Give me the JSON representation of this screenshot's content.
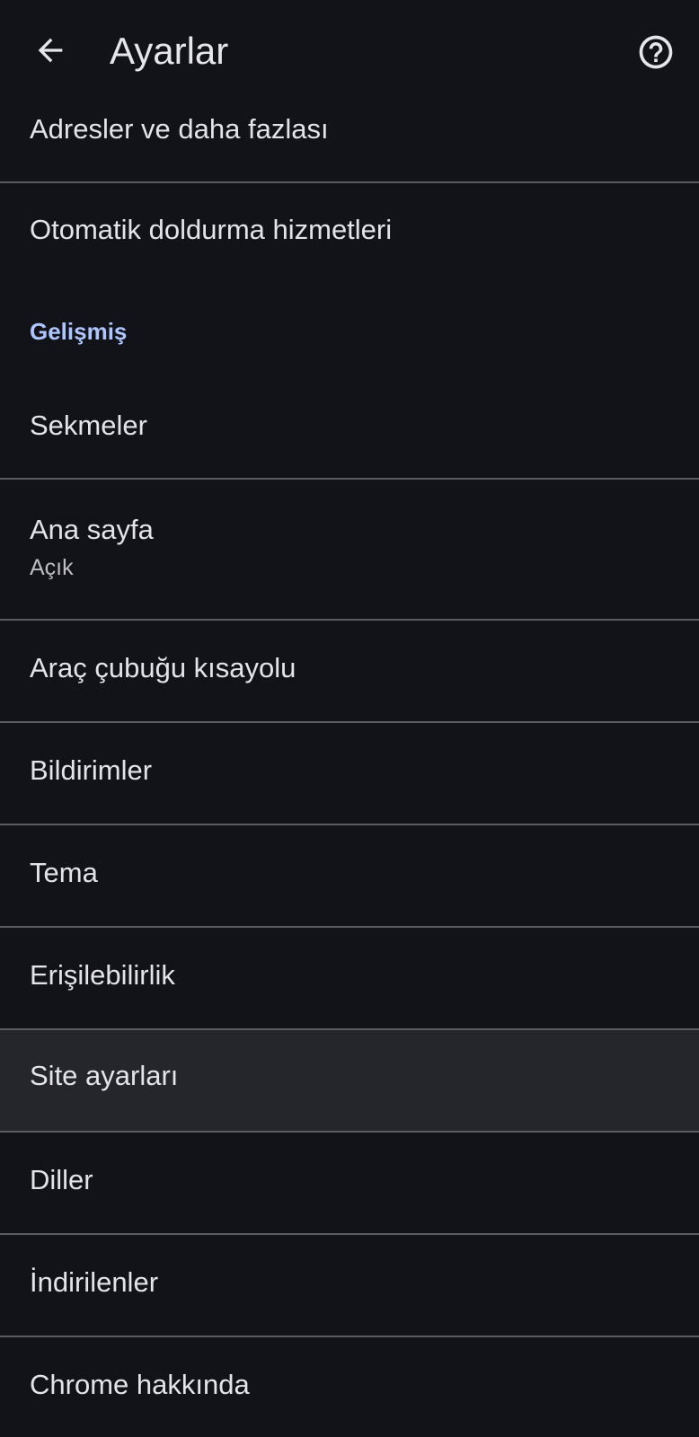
{
  "app_bar": {
    "title": "Ayarlar",
    "back_icon": "arrow-back-icon",
    "help_icon": "help-circle-icon"
  },
  "items": [
    {
      "label": "Adresler ve daha fazlası"
    },
    {
      "label": "Otomatik doldurma hizmetleri"
    },
    {
      "label": "Sekmeler"
    },
    {
      "label": "Ana sayfa",
      "sublabel": "Açık"
    },
    {
      "label": "Araç çubuğu kısayolu"
    },
    {
      "label": "Bildirimler"
    },
    {
      "label": "Tema"
    },
    {
      "label": "Erişilebilirlik"
    },
    {
      "label": "Site ayarları"
    },
    {
      "label": "Diller"
    },
    {
      "label": "İndirilenler"
    },
    {
      "label": "Chrome hakkında"
    }
  ],
  "section": {
    "advanced_header": "Gelişmiş"
  },
  "colors": {
    "background": "#121318",
    "accent": "#aec6ff",
    "divider": "#5b5c62",
    "highlight_row": "#25262c"
  }
}
